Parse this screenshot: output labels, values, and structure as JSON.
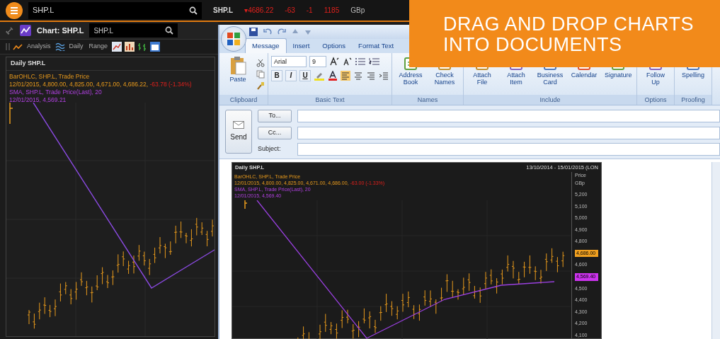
{
  "top_bar": {
    "search": {
      "value": "SHP.L"
    },
    "quote": {
      "symbol": "SHP.L",
      "fields": [
        "▾4686.22",
        "-63",
        "-1",
        "1185"
      ],
      "currency": "GBp"
    }
  },
  "chart_window": {
    "title": "Chart: SHP.L",
    "search": {
      "value": "SHP.L"
    },
    "toolbar": [
      {
        "label": "Analysis"
      },
      {
        "label": "Daily"
      },
      {
        "label": "Range"
      }
    ],
    "chart": {
      "title": "Daily SHP.L",
      "legend": [
        {
          "parts": [
            {
              "text": "BarOHLC, SHP.L, Trade Price",
              "kind": "ohlc"
            }
          ]
        },
        {
          "parts": [
            {
              "text": "12/01/2015, 4,800.00, 4,825.00, 4,671.00, 4,686.22,",
              "kind": "ohlc"
            },
            {
              "text": "-63.78 (-1.34%)",
              "kind": "change"
            }
          ]
        },
        {
          "parts": [
            {
              "text": "SMA, SHP.L, Trade Price(Last), 20",
              "kind": "sma"
            }
          ]
        },
        {
          "parts": [
            {
              "text": "12/01/2015, 4,569.21",
              "kind": "sma"
            }
          ]
        }
      ]
    }
  },
  "email_window": {
    "tabs": [
      {
        "label": "Message",
        "selected": true
      },
      {
        "label": "Insert",
        "selected": false
      },
      {
        "label": "Options",
        "selected": false
      },
      {
        "label": "Format Text",
        "selected": false
      }
    ],
    "ribbon": [
      {
        "kind": "clipboard",
        "label": "Clipboard",
        "items": [
          {
            "label": "Paste"
          }
        ]
      },
      {
        "kind": "basic_text",
        "label": "Basic Text",
        "font": "Arial",
        "size": "9",
        "format_buttons": [
          "B",
          "I",
          "U"
        ]
      },
      {
        "kind": "buttons",
        "label": "Names",
        "items": [
          {
            "label": "Address Book"
          },
          {
            "label": "Check Names"
          }
        ]
      },
      {
        "kind": "buttons",
        "label": "Include",
        "items": [
          {
            "label": "Attach File"
          },
          {
            "label": "Attach Item"
          },
          {
            "label": "Business Card"
          },
          {
            "label": "Calendar"
          },
          {
            "label": "Signature"
          }
        ]
      },
      {
        "kind": "buttons",
        "label": "Options",
        "items": [
          {
            "label": "Follow Up"
          }
        ]
      },
      {
        "kind": "buttons",
        "label": "Proofing",
        "items": [
          {
            "label": "Spelling"
          }
        ]
      }
    ],
    "send": "Send",
    "fields": [
      {
        "kind": "button",
        "label": "To..."
      },
      {
        "kind": "button",
        "label": "Cc..."
      },
      {
        "kind": "text",
        "label": "Subject:"
      }
    ],
    "body_chart": {
      "title": "Daily SHP.L",
      "range": "13/10/2014 - 15/01/2015 (LON",
      "axis_title": [
        "Price",
        "GBp"
      ],
      "legend": [
        {
          "parts": [
            {
              "text": "BarOHLC, SHP.L, Trade Price",
              "kind": "ohlc"
            }
          ]
        },
        {
          "parts": [
            {
              "text": "12/01/2015, 4,800.00, 4,825.00, 4,671.00, 4,686.00,",
              "kind": "ohlc"
            },
            {
              "text": "-63.00 (-1.33%)",
              "kind": "change"
            }
          ]
        },
        {
          "parts": [
            {
              "text": "SMA, SHP.L, Trade Price(Last), 20",
              "kind": "sma"
            }
          ]
        },
        {
          "parts": [
            {
              "text": "12/01/2015, 4,569.40",
              "kind": "sma"
            }
          ]
        }
      ],
      "axis": [
        {
          "kind": "tick",
          "text": "5,200"
        },
        {
          "kind": "tick",
          "text": "5,100"
        },
        {
          "kind": "tick",
          "text": "5,000"
        },
        {
          "kind": "tick",
          "text": "4,900"
        },
        {
          "kind": "tick",
          "text": "4,800"
        },
        {
          "kind": "tag",
          "text": "4,686.00",
          "color": "#f0a020"
        },
        {
          "kind": "tick",
          "text": "4,600"
        },
        {
          "kind": "tag",
          "text": "4,569.40",
          "color": "#cc33ee"
        },
        {
          "kind": "tick",
          "text": "4,500"
        },
        {
          "kind": "tick",
          "text": "4,400"
        },
        {
          "kind": "tick",
          "text": "4,300"
        },
        {
          "kind": "tick",
          "text": "4,200"
        },
        {
          "kind": "tick",
          "text": "4,100"
        }
      ]
    }
  },
  "banner": {
    "lines": [
      "DRAG AND DROP CHARTS",
      "INTO DOCUMENTS"
    ]
  }
}
